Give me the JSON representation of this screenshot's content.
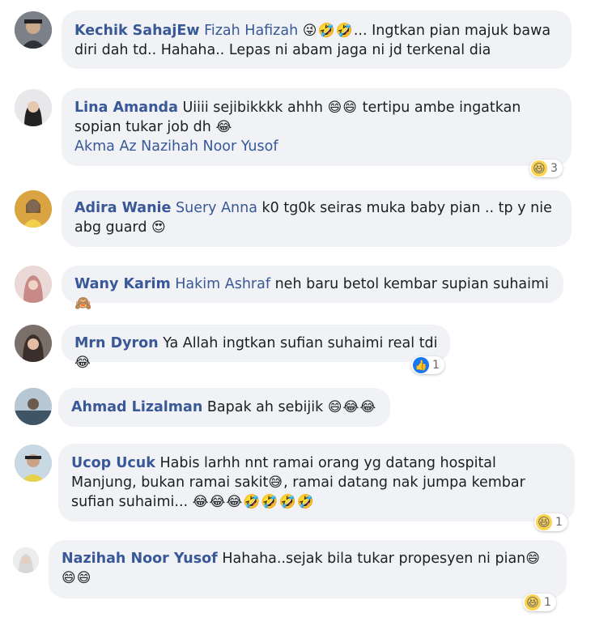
{
  "comments": [
    {
      "author": "Kechik SahajEw",
      "mention": "Fizah Hafizah",
      "emoji": "😜🤣🤣",
      "text": "... Ingtkan pian majuk bawa diri dah td.. Hahaha.. Lepas ni abam jaga ni jd terkenal dia"
    },
    {
      "author": "Lina Amanda",
      "text1": "Uiiii sejibikkkk ahhh",
      "emoji1": "😄😄",
      "text2": "tertipu ambe ingatkan sopian tukar job dh",
      "emoji2": "😂",
      "tag": "Akma Az Nazihah Noor Yusof",
      "reaction": {
        "icon": "haha-icon",
        "count": "3"
      }
    },
    {
      "author": "Adira Wanie",
      "mention": "Suery Anna",
      "text": "k0 tg0k seiras muka baby pian .. tp y nie abg guard",
      "emoji": "😍"
    },
    {
      "author": "Wany Karim",
      "mention": "Hakim Ashraf",
      "text": "neh baru betol kembar supian suhaimi",
      "emoji": "🙈"
    },
    {
      "author": "Mrn Dyron",
      "text": "Ya Allah ingtkan sufian suhaimi real tdi",
      "emoji": "😂",
      "reaction": {
        "icon": "like-icon",
        "count": "1"
      }
    },
    {
      "author": "Ahmad Lizalman",
      "text": "Bapak ah sebijik",
      "emoji": "😄😂😂"
    },
    {
      "author": "Ucop Ucuk",
      "text1": "Habis larhh nnt ramai orang yg datang hospital Manjung, bukan ramai sakit",
      "emoji1": "😅",
      "text2": ", ramai datang nak jumpa kembar sufian suhaimi...",
      "emoji2": "😂😂😂🤣🤣🤣🤣",
      "reaction": {
        "icon": "haha-icon",
        "count": "1"
      }
    },
    {
      "author": "Nazihah Noor Yusof",
      "text": "Hahaha..sejak bila tukar propesyen ni pian",
      "emoji": "😄😄😄",
      "reaction": {
        "icon": "haha-icon",
        "count": "1"
      }
    }
  ],
  "icons": {
    "like": "👍",
    "haha": "😆"
  },
  "colors": {
    "bubble": "#f0f2f5",
    "link": "#385898",
    "like": "#1877f2"
  }
}
